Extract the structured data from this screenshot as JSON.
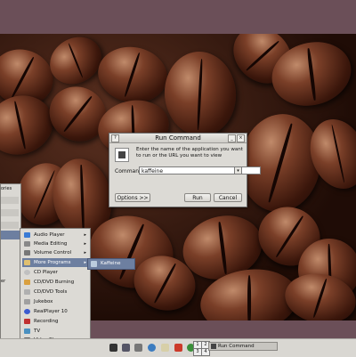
{
  "dialog": {
    "title": "Run Command",
    "message": "Enter the name of the application you want to run or the URL you want to view",
    "command_label": "Command:",
    "command_value": "kaffeine",
    "options_label": "Options >>",
    "run_label": "Run",
    "cancel_label": "Cancel"
  },
  "menu": {
    "left_items": [
      "ories",
      "",
      "",
      "",
      "",
      "",
      "",
      "er"
    ],
    "items": [
      {
        "label": "Audio Player",
        "arrow": "▸"
      },
      {
        "label": "Media Editing",
        "arrow": "▸"
      },
      {
        "label": "Volume Control",
        "arrow": "▸"
      },
      {
        "label": "More Programs",
        "arrow": "▸"
      },
      {
        "label": "CD Player",
        "arrow": ""
      },
      {
        "label": "CD/DVD Burning",
        "arrow": ""
      },
      {
        "label": "CD/DVD Tools",
        "arrow": ""
      },
      {
        "label": "Jukebox",
        "arrow": ""
      },
      {
        "label": "RealPlayer 10",
        "arrow": ""
      },
      {
        "label": "Recording",
        "arrow": ""
      },
      {
        "label": "TV",
        "arrow": ""
      },
      {
        "label": "Video Player",
        "arrow": ""
      }
    ],
    "submenu_item": "Kaffeine"
  },
  "panel": {
    "workspaces": [
      "1",
      "2",
      "3",
      "4"
    ],
    "task_label": "Run Command"
  },
  "colors": {
    "selection": "#6d7fa0",
    "frame": "#6b4f58"
  }
}
